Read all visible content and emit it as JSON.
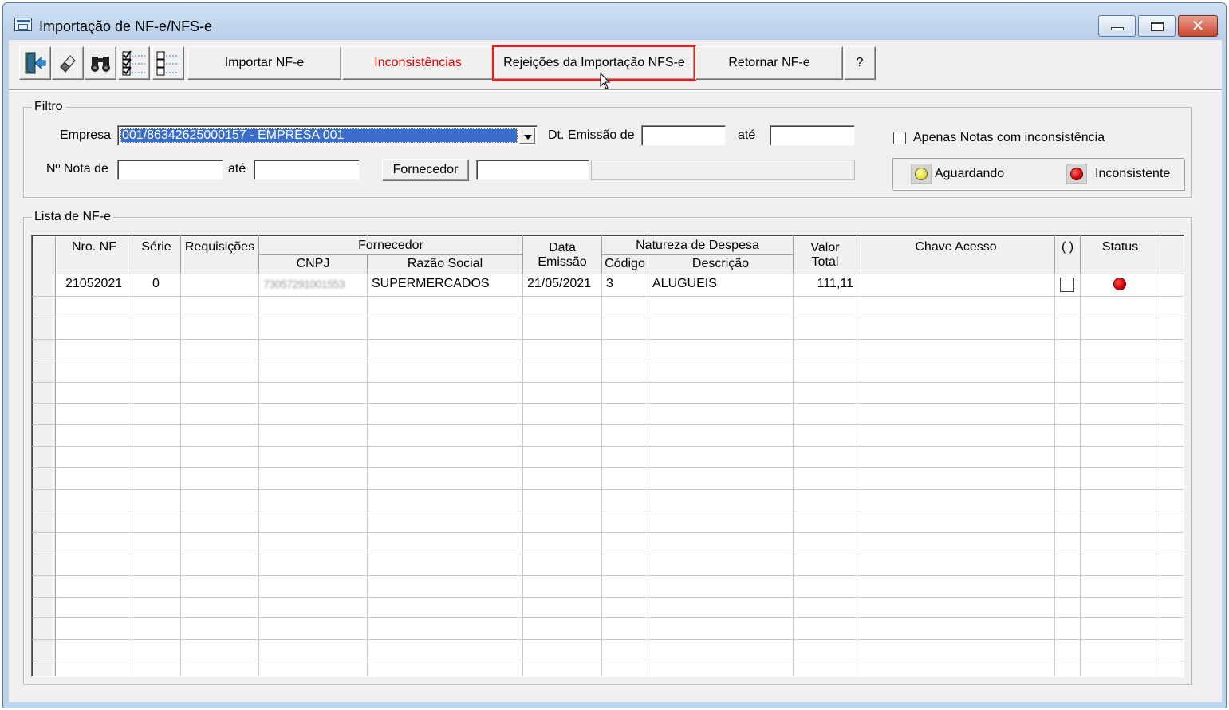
{
  "window": {
    "title": "Importação de NF-e/NFS-e"
  },
  "toolbar": {
    "icons": [
      "exit-icon",
      "eraser-icon",
      "binoculars-icon",
      "check-all-icon",
      "uncheck-all-icon"
    ],
    "importar": "Importar NF-e",
    "inconsistencias": "Inconsistências",
    "rejeicoes": "Rejeições da Importação NFS-e",
    "retornar": "Retornar NF-e",
    "help": "?"
  },
  "filtro": {
    "legend": "Filtro",
    "empresa_label": "Empresa",
    "empresa_value": "001/86342625000157 - EMPRESA 001",
    "dt_emissao_label": "Dt. Emissão de",
    "ate1": "até",
    "nota_label": "Nº Nota de",
    "ate2": "até",
    "fornecedor_button": "Fornecedor",
    "apenas_label": "Apenas Notas com inconsistência",
    "aguardando": "Aguardando",
    "inconsistente": "Inconsistente"
  },
  "lista": {
    "legend": "Lista de NF-e",
    "headers": {
      "nro_nf": "Nro. NF",
      "serie": "Série",
      "requisicoes": "Requisições",
      "fornecedor": "Fornecedor",
      "cnpj": "CNPJ",
      "razao": "Razão Social",
      "data1": "Data",
      "data2": "Emissão",
      "natureza": "Natureza de Despesa",
      "codigo": "Código",
      "descricao": "Descrição",
      "valor1": "Valor",
      "valor2": "Total",
      "chave": "Chave Acesso",
      "check": "( )",
      "status": "Status"
    },
    "rows": [
      {
        "nro_nf": "21052021",
        "serie": "0",
        "requisicoes": "",
        "cnpj": "73057291001553",
        "razao": "SUPERMERCADOS",
        "data": "21/05/2021",
        "codigo": "3",
        "descricao": "ALUGUEIS",
        "valor": "111,11",
        "chave": "",
        "status_color": "#d40000"
      }
    ]
  },
  "colors": {
    "accent_red": "#e00000",
    "highlight": "#e21f1f",
    "selection": "#3a6ec9",
    "waiting_yellow": "#e6e24a",
    "inconsistent_red": "#d40000"
  }
}
